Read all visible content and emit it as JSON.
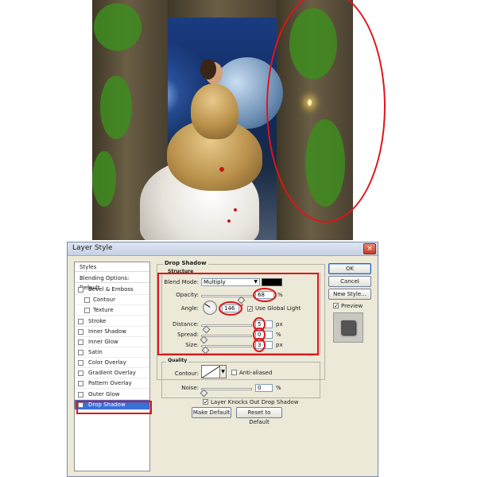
{
  "dialog": {
    "title": "Layer Style",
    "close_glyph": "×"
  },
  "styles_panel": {
    "header": "Styles",
    "blending": "Blending Options: Default",
    "items": [
      {
        "label": "Bevel & Emboss",
        "checked": false
      },
      {
        "label": "Contour",
        "checked": false,
        "sub": true
      },
      {
        "label": "Texture",
        "checked": false,
        "sub": true
      },
      {
        "label": "Stroke",
        "checked": false
      },
      {
        "label": "Inner Shadow",
        "checked": false
      },
      {
        "label": "Inner Glow",
        "checked": false
      },
      {
        "label": "Satin",
        "checked": false
      },
      {
        "label": "Color Overlay",
        "checked": false
      },
      {
        "label": "Gradient Overlay",
        "checked": false
      },
      {
        "label": "Pattern Overlay",
        "checked": false
      },
      {
        "label": "Outer Glow",
        "checked": false
      },
      {
        "label": "Drop Shadow",
        "checked": true,
        "selected": true
      }
    ]
  },
  "drop_shadow": {
    "section_title": "Drop Shadow",
    "structure_title": "Structure",
    "blend_mode_label": "Blend Mode:",
    "blend_mode_value": "Multiply",
    "shadow_color": "#000000",
    "opacity_label": "Opacity:",
    "opacity_value": "68",
    "opacity_unit": "%",
    "angle_label": "Angle:",
    "angle_value": "146",
    "angle_unit": "°",
    "use_global_light_label": "Use Global Light",
    "use_global_light_checked": true,
    "distance_label": "Distance:",
    "distance_value": "5",
    "distance_unit": "px",
    "spread_label": "Spread:",
    "spread_value": "0",
    "spread_unit": "%",
    "size_label": "Size:",
    "size_value": "3",
    "size_unit": "px",
    "quality_title": "Quality",
    "contour_label": "Contour:",
    "anti_aliased_label": "Anti-aliased",
    "anti_aliased_checked": false,
    "noise_label": "Noise:",
    "noise_value": "0",
    "noise_unit": "%",
    "layer_knocks_out_label": "Layer Knocks Out Drop Shadow",
    "layer_knocks_out_checked": true,
    "make_default_label": "Make Default",
    "reset_default_label": "Reset to Default"
  },
  "buttons": {
    "ok": "OK",
    "cancel": "Cancel",
    "new_style": "New Style...",
    "preview_label": "Preview",
    "preview_checked": true
  },
  "annotations": {
    "highlight_color": "#e0141a"
  },
  "accent_colors": {
    "selection": "#3a6fd8",
    "dialog_bg": "#ece9d8"
  }
}
